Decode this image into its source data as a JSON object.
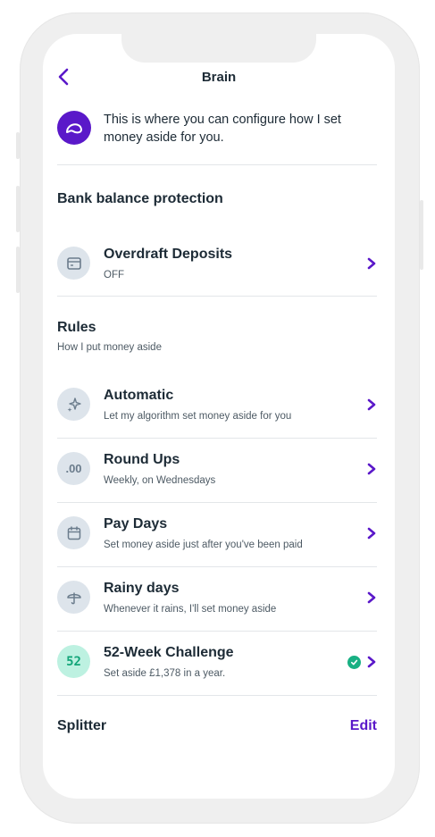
{
  "header": {
    "title": "Brain"
  },
  "intro": {
    "text": "This is where you can configure how I set money aside for you."
  },
  "bank_balance": {
    "title": "Bank balance protection",
    "items": [
      {
        "label": "Overdraft Deposits",
        "sub": "OFF",
        "icon": "overdraft-card-icon"
      }
    ]
  },
  "rules": {
    "title": "Rules",
    "subtitle": "How I put money aside",
    "items": [
      {
        "label": "Automatic",
        "sub": "Let my algorithm set money aside for you",
        "icon": "sparkle-icon"
      },
      {
        "label": "Round Ups",
        "sub": "Weekly, on Wednesdays",
        "icon": "round-up-icon",
        "icon_text": ".00"
      },
      {
        "label": "Pay Days",
        "sub": "Set money aside just after you've been paid",
        "icon": "calendar-icon"
      },
      {
        "label": "Rainy days",
        "sub": "Whenever it rains, I'll set money aside",
        "icon": "umbrella-icon"
      },
      {
        "label": "52-Week Challenge",
        "sub": "Set aside £1,378 in a year.",
        "icon": "fifty-two-icon",
        "icon_text": "52",
        "active": true
      }
    ]
  },
  "splitter": {
    "title": "Splitter",
    "edit_label": "Edit"
  },
  "colors": {
    "accent": "#5a18c9",
    "icon_bg": "#dde4eb",
    "success": "#18b083",
    "text": "#1d2b36"
  }
}
